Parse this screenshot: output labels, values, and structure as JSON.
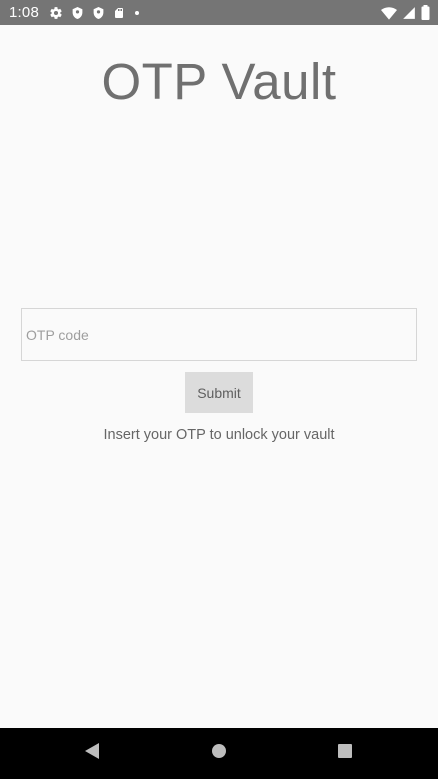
{
  "status_bar": {
    "time": "1:08",
    "left_icons": [
      "settings-icon",
      "shield-icon",
      "shield-icon",
      "sd-card-icon",
      "dot-icon"
    ],
    "right_icons": [
      "wifi-icon",
      "cellular-signal-icon",
      "battery-icon"
    ]
  },
  "app": {
    "title": "OTP Vault",
    "otp_input": {
      "value": "",
      "placeholder": "OTP code"
    },
    "submit_label": "Submit",
    "hint": "Insert your OTP to unlock your vault"
  },
  "nav_bar": {
    "buttons": [
      "back-icon",
      "home-icon",
      "recents-icon"
    ]
  },
  "colors": {
    "status_bar_bg": "#757575",
    "background": "#fafafa",
    "title": "#707070",
    "button_bg": "#dcdcdc",
    "nav_bar_bg": "#000000"
  }
}
